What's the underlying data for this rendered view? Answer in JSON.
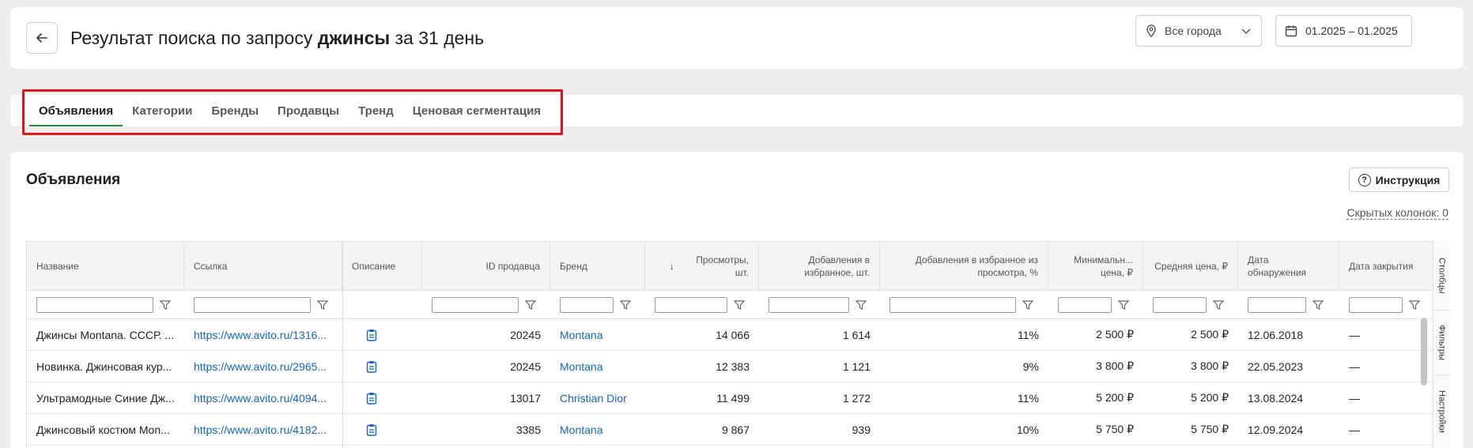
{
  "header": {
    "title_prefix": "Результат поиска по запросу",
    "title_query": "джинсы",
    "title_suffix": "за 31 день",
    "city": "Все города",
    "date_range": "01.2025 – 01.2025"
  },
  "tabs": [
    {
      "label": "Объявления",
      "active": true
    },
    {
      "label": "Категории"
    },
    {
      "label": "Бренды"
    },
    {
      "label": "Продавцы"
    },
    {
      "label": "Тренд"
    },
    {
      "label": "Ценовая сегментация"
    }
  ],
  "section": {
    "title": "Объявления",
    "instruction_label": "Инструкция",
    "hidden_columns": "Скрытых колонок: 0"
  },
  "table": {
    "columns": {
      "name": "Название",
      "link": "Ссылка",
      "desc": "Описание",
      "seller": "ID продавца",
      "brand": "Бренд",
      "views": "Просмотры, шт.",
      "fav": "Добавления в избранное, шт.",
      "favpct": "Добавления в избранное из просмотра, %",
      "minprice": "Минимальн... цена, ₽",
      "avgprice": "Средняя цена, ₽",
      "found": "Дата обнаружения",
      "closed": "Дата закрытия"
    },
    "rows": [
      {
        "name": "Джинсы Montana. СССР. ...",
        "link": "https://www.avito.ru/1316...",
        "seller": "20245",
        "brand": "Montana",
        "views": "14 066",
        "fav": "1 614",
        "favpct": "11%",
        "minprice": "2 500 ₽",
        "avgprice": "2 500 ₽",
        "found": "12.06.2018",
        "closed": "—"
      },
      {
        "name": "Новинка. Джинсовая кур...",
        "link": "https://www.avito.ru/2965...",
        "seller": "20245",
        "brand": "Montana",
        "views": "12 383",
        "fav": "1 121",
        "favpct": "9%",
        "minprice": "3 800 ₽",
        "avgprice": "3 800 ₽",
        "found": "22.05.2023",
        "closed": "—"
      },
      {
        "name": "Ультрамодные Синие Дж...",
        "link": "https://www.avito.ru/4094...",
        "seller": "13017",
        "brand": "Christian Dior",
        "views": "11 499",
        "fav": "1 272",
        "favpct": "11%",
        "minprice": "5 200 ₽",
        "avgprice": "5 200 ₽",
        "found": "13.08.2024",
        "closed": "—"
      },
      {
        "name": "Джинсовый костюм Mon...",
        "link": "https://www.avito.ru/4182...",
        "seller": "3385",
        "brand": "Montana",
        "views": "9 867",
        "fav": "939",
        "favpct": "10%",
        "minprice": "5 750 ₽",
        "avgprice": "5 750 ₽",
        "found": "12.09.2024",
        "closed": "—"
      }
    ]
  },
  "side_panel": {
    "columns_label": "Столбцы",
    "filters_label": "Фильтры",
    "settings_label": "Настройки"
  },
  "colors": {
    "accent_green": "#2b8a3e",
    "highlight_red": "#e2141b",
    "link_blue": "#1565c0"
  }
}
